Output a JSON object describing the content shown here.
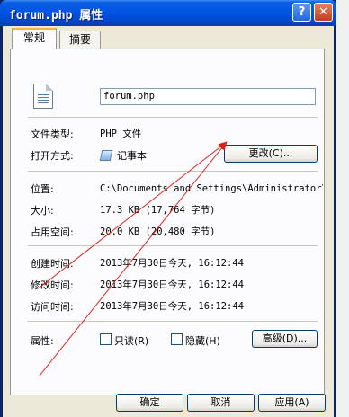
{
  "window": {
    "title": "forum.php 属性",
    "help_glyph": "?",
    "close_glyph": "✕"
  },
  "tabs": [
    {
      "label": "常规",
      "active": true
    },
    {
      "label": "摘要",
      "active": false
    }
  ],
  "file": {
    "name": "forum.php",
    "type_label": "文件类型:",
    "type_value": "PHP 文件",
    "opens_label": "打开方式:",
    "opens_value": "记事本",
    "change_button": "更改(C)..."
  },
  "details": {
    "location_label": "位置:",
    "location_value": "C:\\Documents and Settings\\Administrator\\桌",
    "size_label": "大小:",
    "size_value": "17.3 KB (17,764 字节)",
    "disk_label": "占用空间:",
    "disk_value": "20.0 KB (20,480 字节)"
  },
  "times": {
    "created_label": "创建时间:",
    "created_value": "2013年7月30日今天, 16:12:44",
    "modified_label": "修改时间:",
    "modified_value": "2013年7月30日今天, 16:12:44",
    "accessed_label": "访问时间:",
    "accessed_value": "2013年7月30日今天, 16:12:44"
  },
  "attributes": {
    "label": "属性:",
    "readonly_label": "只读(R)",
    "readonly_checked": false,
    "hidden_label": "隐藏(H)",
    "hidden_checked": false,
    "advanced_button": "高级(D)..."
  },
  "footer": {
    "ok": "确定",
    "cancel": "取消",
    "apply": "应用(A)"
  },
  "colors": {
    "annotation_arrow": "#e0201a",
    "titlebar": "#0055e5",
    "dialog_bg": "#ece9d8"
  }
}
